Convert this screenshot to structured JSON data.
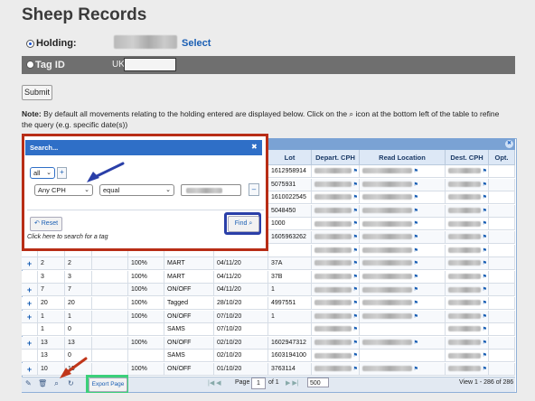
{
  "page": {
    "title": "Sheep Records"
  },
  "form": {
    "holding_label": "Holding:",
    "select_link": "Select",
    "tagid_label": "Tag ID",
    "uk_prefix": "UK",
    "submit_label": "Submit",
    "note_bold": "Note:",
    "note_text": "By default all movements relating to the holding entered are displayed below. Click on the ⌕ icon at the bottom left of the table to refine the query (e.g. specific date(s))"
  },
  "table": {
    "columns": [
      "",
      "",
      "",
      "",
      "",
      "",
      "",
      "Lot",
      "Depart. CPH",
      "Read Location",
      "Dest. CPH",
      "Opt."
    ],
    "rows": [
      {
        "a": "",
        "b": "",
        "c": "",
        "pct": "",
        "type": "",
        "date": "",
        "lot": "1612958914"
      },
      {
        "a": "",
        "b": "",
        "c": "",
        "pct": "",
        "type": "",
        "date": "",
        "lot": "5075931"
      },
      {
        "a": "",
        "b": "",
        "c": "",
        "pct": "",
        "type": "",
        "date": "",
        "lot": "1610022545"
      },
      {
        "a": "",
        "b": "",
        "c": "",
        "pct": "",
        "type": "",
        "date": "",
        "lot": "5048450"
      },
      {
        "a": "",
        "b": "",
        "c": "",
        "pct": "",
        "type": "",
        "date": "",
        "lot": "1000"
      },
      {
        "a": "",
        "b": "",
        "c": "",
        "pct": "",
        "type": "",
        "date": "",
        "lot": "1605963262"
      },
      {
        "a": "",
        "b": "",
        "c": "",
        "pct": "",
        "type": "",
        "date": "",
        "lot": ""
      },
      {
        "a": "2",
        "b": "2",
        "c": "",
        "pct": "100%",
        "type": "MART",
        "date": "04/11/20",
        "lot": "37A"
      },
      {
        "a": "3",
        "b": "3",
        "c": "",
        "pct": "100%",
        "type": "MART",
        "date": "04/11/20",
        "lot": "37B"
      },
      {
        "a": "7",
        "b": "7",
        "c": "",
        "pct": "100%",
        "type": "ON/OFF",
        "date": "04/11/20",
        "lot": "1"
      },
      {
        "a": "20",
        "b": "20",
        "c": "",
        "pct": "100%",
        "type": "Tagged",
        "date": "28/10/20",
        "lot": "4997551"
      },
      {
        "a": "1",
        "b": "1",
        "c": "",
        "pct": "100%",
        "type": "ON/OFF",
        "date": "07/10/20",
        "lot": "1"
      },
      {
        "a": "1",
        "b": "0",
        "c": "",
        "pct": "",
        "type": "SAMS",
        "date": "07/10/20",
        "lot": ""
      },
      {
        "a": "13",
        "b": "13",
        "c": "",
        "pct": "100%",
        "type": "ON/OFF",
        "date": "02/10/20",
        "lot": "1602947312"
      },
      {
        "a": "13",
        "b": "0",
        "c": "",
        "pct": "",
        "type": "SAMS",
        "date": "02/10/20",
        "lot": "1603194100"
      },
      {
        "a": "10",
        "b": "10",
        "c": "",
        "pct": "100%",
        "type": "ON/OFF",
        "date": "01/10/20",
        "lot": "3763114"
      }
    ]
  },
  "pager": {
    "export_label": "Export Page",
    "page_label": "Page",
    "page_value": "1",
    "of_label": "of 1",
    "per_page": "500",
    "view_text": "View 1 - 286 of 286"
  },
  "search_dialog": {
    "title": "Search...",
    "close": "✖",
    "group_op": "all",
    "field": "Any CPH",
    "operator": "equal",
    "reset_label": "Reset",
    "find_label": "Find",
    "hint": "Click here to search for a tag"
  },
  "colors": {
    "red_box": "#b82d16",
    "blue_box": "#2a3fa8",
    "green_box": "#3bd07a",
    "arrow_blue": "#2a3fa8",
    "arrow_red": "#c0361a"
  }
}
